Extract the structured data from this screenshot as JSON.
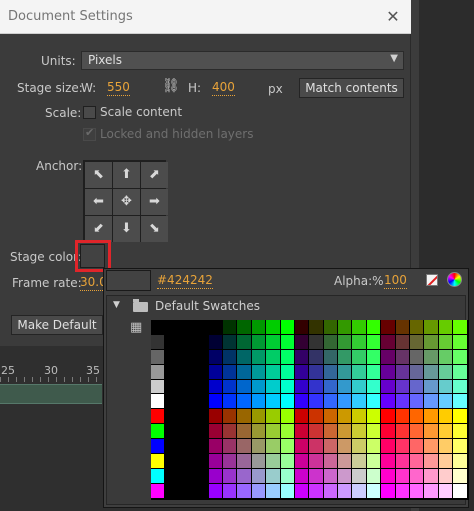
{
  "dialog": {
    "title": "Document Settings",
    "close_glyph": "✕",
    "units_label": "Units:",
    "units_value": "Pixels",
    "stage_size_label": "Stage size:",
    "w_label": "W:",
    "w_value": "550",
    "h_label": "H:",
    "h_value": "400",
    "px_label": "px",
    "match_contents": "Match contents",
    "scale_label": "Scale:",
    "scale_content": "Scale content",
    "locked_hidden": "Locked and hidden layers",
    "anchor_label": "Anchor:",
    "anchor_glyphs": [
      "⬉",
      "⬆",
      "⬈",
      "⬅",
      "✥",
      "➡",
      "⬋",
      "⬇",
      "⬊"
    ],
    "stage_color_label": "Stage color:",
    "frame_rate_label": "Frame rate:",
    "frame_rate_value": "30.0",
    "make_default": "Make Default"
  },
  "timeline": {
    "ticks": [
      "25",
      "30",
      "35"
    ]
  },
  "color_popup": {
    "hex": "#424242",
    "alpha_label": "Alpha:%",
    "alpha_value": "100",
    "folder_name": "Default Swatches",
    "current_color": "#424242"
  },
  "colors": {
    "accent": "#e8a339",
    "highlight": "#e0252a"
  }
}
